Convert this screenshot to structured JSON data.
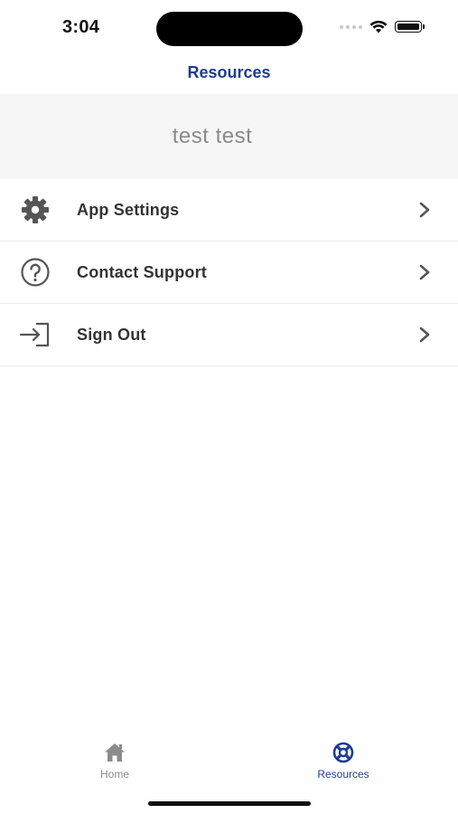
{
  "status_bar": {
    "time": "3:04"
  },
  "header": {
    "title": "Resources"
  },
  "profile": {
    "name": "test test"
  },
  "menu": {
    "items": [
      {
        "label": "App Settings",
        "icon": "gear-icon"
      },
      {
        "label": "Contact Support",
        "icon": "question-circle-icon"
      },
      {
        "label": "Sign Out",
        "icon": "sign-out-icon"
      }
    ]
  },
  "tab_bar": {
    "tabs": [
      {
        "label": "Home",
        "icon": "home-icon",
        "active": false
      },
      {
        "label": "Resources",
        "icon": "lifebuoy-icon",
        "active": true
      }
    ]
  },
  "colors": {
    "accent": "#1f3d8f",
    "inactive": "#8c8c8c",
    "label": "#333333",
    "profile_background": "#f6f6f6"
  }
}
